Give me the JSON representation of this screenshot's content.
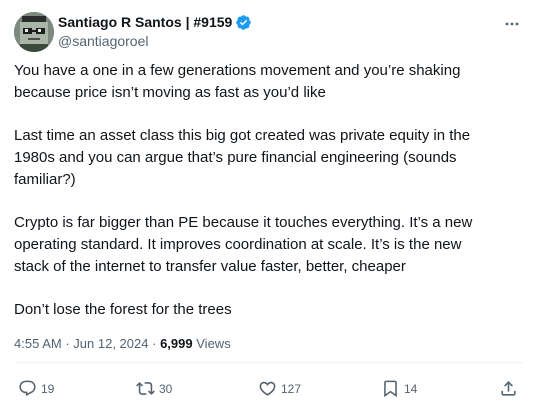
{
  "author": {
    "display_name": "Santiago R Santos | #9159",
    "handle": "@santiagoroel",
    "avatar_icon": "pixel-art-avatar-icon",
    "verified_icon": "verified-badge-icon",
    "verified_color": "#1d9bf0"
  },
  "tweet": {
    "paragraphs": [
      "You have a one in a few generations movement and you’re shaking\nbecause price isn’t moving as fast as you’d like",
      "Last time an asset class this big got created was private equity in the\n1980s and you can argue that’s pure financial engineering (sounds\nfamiliar?)",
      "Crypto is far bigger than PE because it touches everything. It’s a new\noperating standard. It improves coordination at scale. It’s is the new\nstack of the internet to transfer value faster, better, cheaper",
      "Don’t lose the forest for the trees"
    ],
    "time": "4:55 AM",
    "separator": "·",
    "date": "Jun 12, 2024",
    "views_count": "6,999",
    "views_label": "Views"
  },
  "actions": {
    "replies": "19",
    "reposts": "30",
    "likes": "127",
    "bookmarks": "14"
  },
  "colors": {
    "text": "#0f1419",
    "secondary": "#536471",
    "divider": "#eff3f4"
  }
}
